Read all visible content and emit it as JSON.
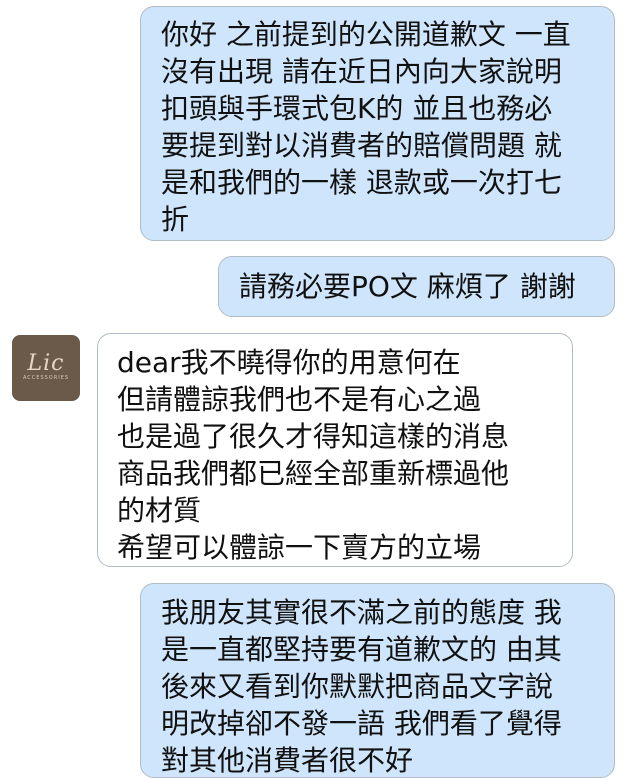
{
  "messages": [
    {
      "direction": "outgoing",
      "text": "你好 之前提到的公開道歉文 一直\n沒有出現 請在近日內向大家說明\n扣頭與手環式包K的 並且也務必\n要提到對以消費者的賠償問題 就\n是和我們的一樣 退款或一次打七\n折"
    },
    {
      "direction": "outgoing",
      "text": "請務必要PO文 麻煩了 謝謝"
    },
    {
      "direction": "incoming",
      "text": "dear我不曉得你的用意何在\n但請體諒我們也不是有心之過\n也是過了很久才得知這樣的消息\n商品我們都已經全部重新標過他\n的材質\n希望可以體諒一下賣方的立場"
    },
    {
      "direction": "outgoing",
      "text": "我朋友其實很不滿之前的態度 我\n是一直都堅持要有道歉文的 由其\n後來又看到你默默把商品文字說\n明改掉卻不發一語 我們看了覺得\n對其他消費者很不好"
    }
  ],
  "avatar": {
    "logo_text": "Lic",
    "subtext": "ACCESSORIES"
  },
  "colors": {
    "outgoing_bubble": "#cfe5fb",
    "incoming_bubble": "#ffffff",
    "bubble_border": "#b2bcc6",
    "avatar_bg": "#6b5a4a"
  }
}
